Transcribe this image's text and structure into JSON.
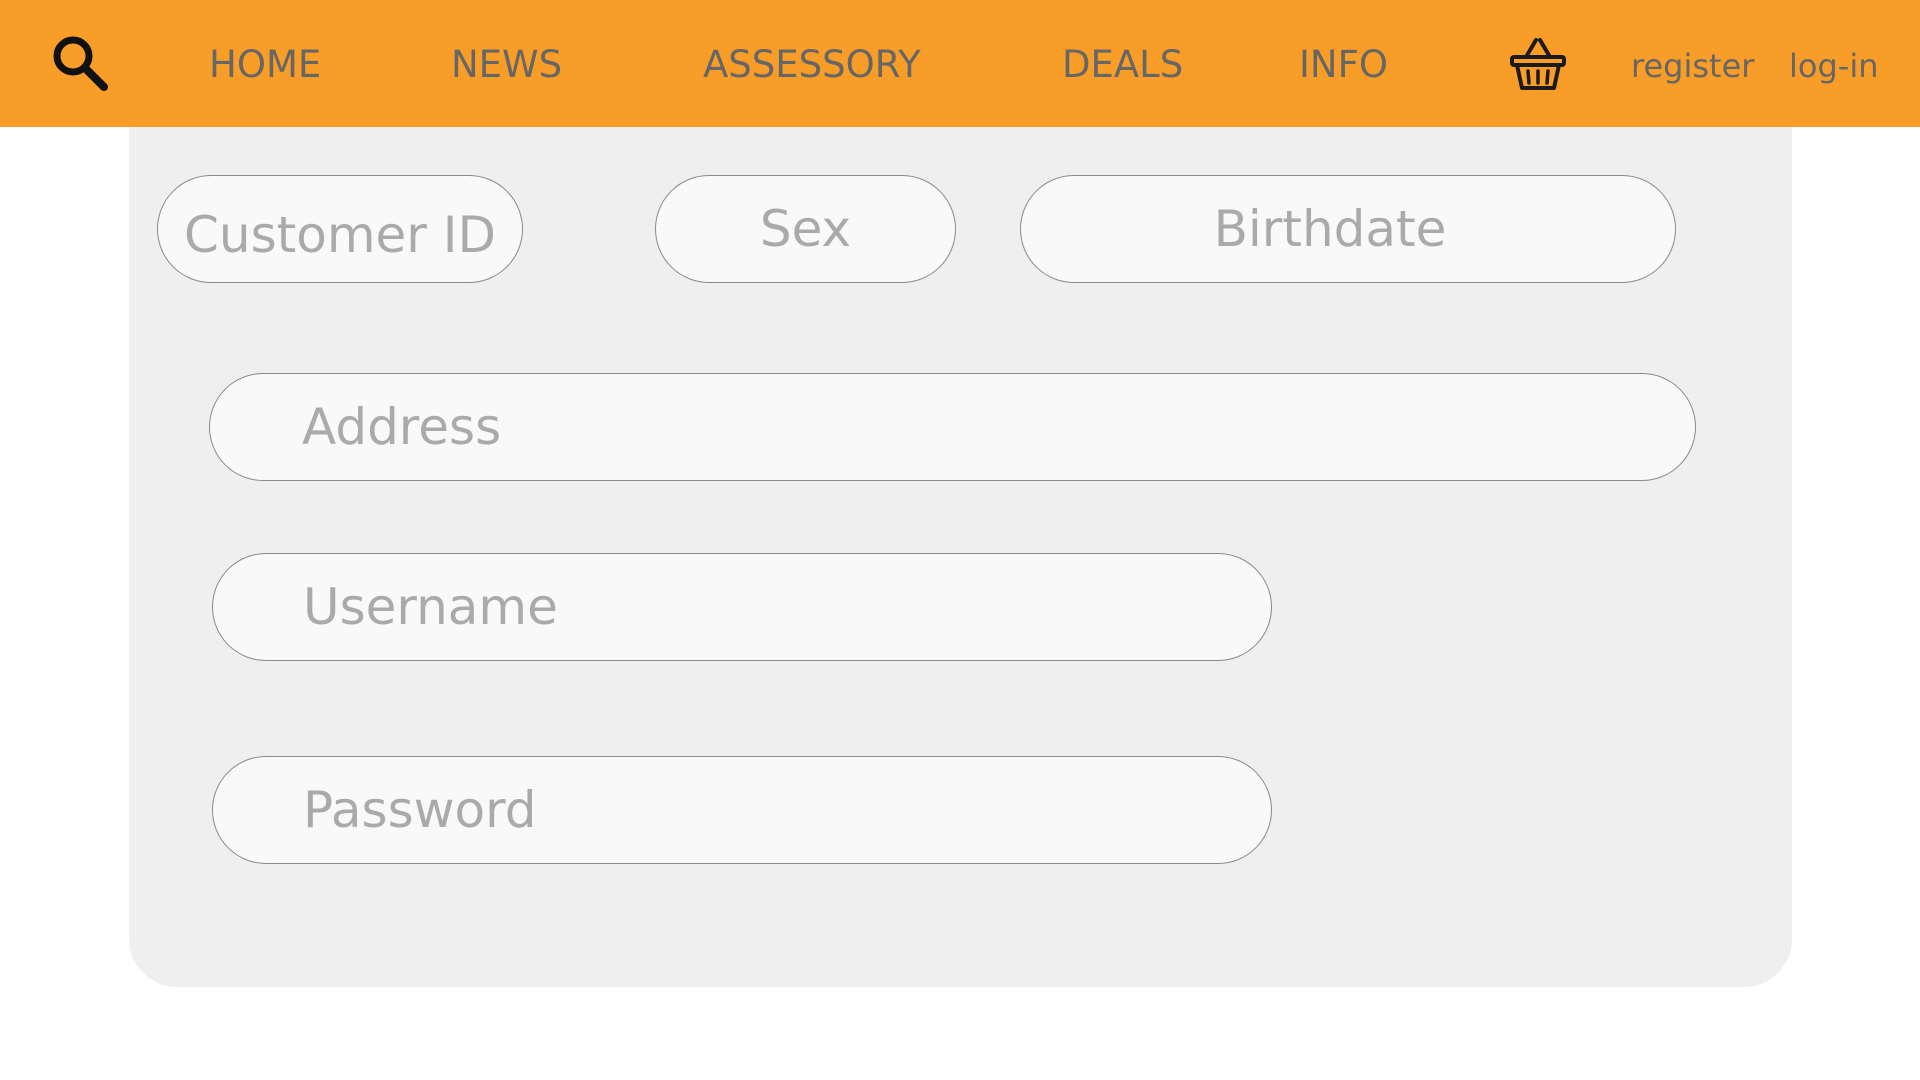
{
  "header": {
    "search_icon": "search-icon",
    "nav_items": [
      "HOME",
      "NEWS",
      "ASSESSORY",
      "DEALS",
      "INFO"
    ],
    "basket_icon": "basket-icon",
    "register_label": "register",
    "login_label": "log-in"
  },
  "form": {
    "customer_id": "Customer ID",
    "sex": "Sex",
    "birthdate": "Birthdate",
    "address": "Address",
    "username": "Username",
    "password": "Password"
  },
  "colors": {
    "header_bg": "#f89d27",
    "panel_bg": "#efefef",
    "field_bg": "#f9f9f9",
    "field_text": "#aaaaaa",
    "nav_text": "#666666"
  }
}
